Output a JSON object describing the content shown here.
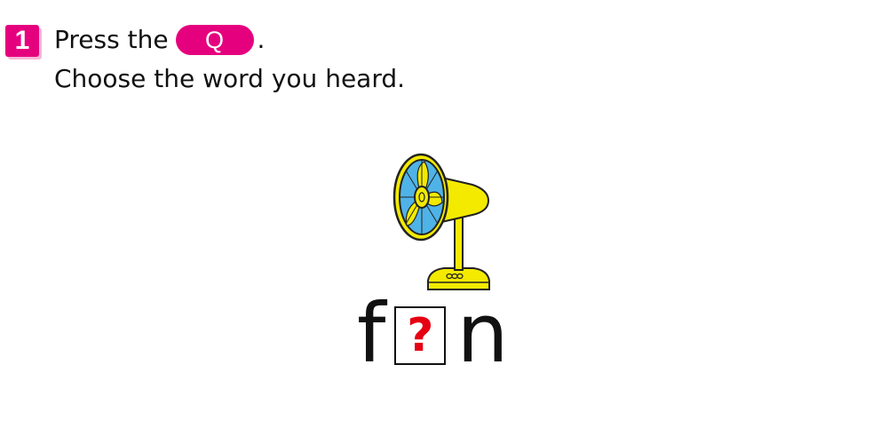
{
  "question": {
    "number": "1",
    "line1_before": "Press the",
    "button_label": "Q",
    "line1_after": ".",
    "line2": "Choose the word you heard."
  },
  "picture": {
    "icon": "fan-icon",
    "colors": {
      "body": "#f3ea00",
      "blades": "#4fb3e8",
      "blade_highlight": "#f3ea00",
      "outline": "#222222"
    }
  },
  "word": {
    "first_letter": "f",
    "blank": "?",
    "last_letter": "n"
  },
  "colors": {
    "accent": "#e5007e",
    "question_mark": "#e60012",
    "text": "#111111"
  }
}
